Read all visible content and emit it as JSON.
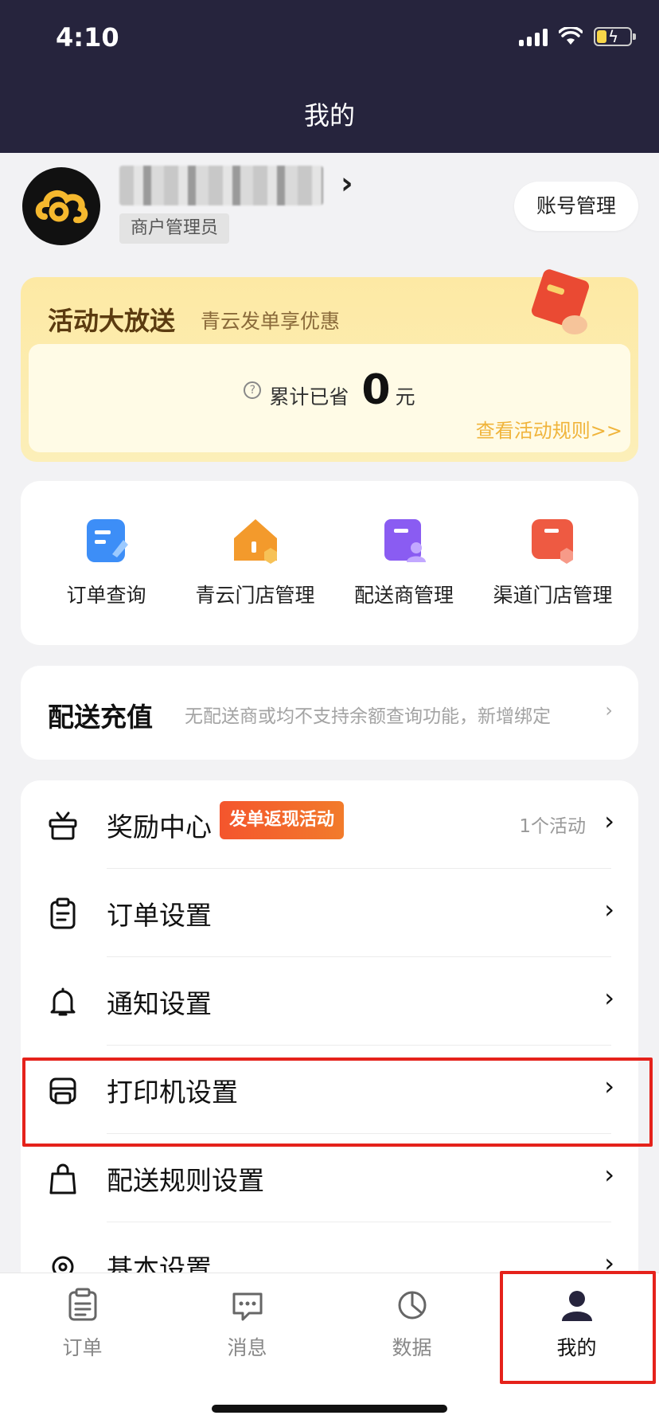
{
  "status_bar": {
    "time": "4:10"
  },
  "header": {
    "title": "我的"
  },
  "profile": {
    "name": "████████",
    "role": "商户管理员",
    "account_button": "账号管理"
  },
  "promo": {
    "title": "活动大放送",
    "subtitle": "青云发单享优惠",
    "saved_label": "累计已省",
    "saved_value": "0",
    "saved_unit": "元",
    "rules_link": "查看活动规则>>"
  },
  "shortcuts": [
    {
      "label": "订单查询",
      "icon": "order-search-icon",
      "color": "#3d8ef7"
    },
    {
      "label": "青云门店管理",
      "icon": "store-icon",
      "color": "#f39a2c"
    },
    {
      "label": "配送商管理",
      "icon": "courier-icon",
      "color": "#8a5cf2"
    },
    {
      "label": "渠道门店管理",
      "icon": "channel-store-icon",
      "color": "#ee5a42"
    }
  ],
  "recharge": {
    "title": "配送充值",
    "note": "无配送商或均不支持余额查询功能，新增绑定"
  },
  "settings": {
    "items": [
      {
        "label": "奖励中心",
        "icon": "gift-icon",
        "badge": "发单返现活动",
        "count": "1个活动"
      },
      {
        "label": "订单设置",
        "icon": "clipboard-icon"
      },
      {
        "label": "通知设置",
        "icon": "bell-icon"
      },
      {
        "label": "打印机设置",
        "icon": "printer-icon"
      },
      {
        "label": "配送规则设置",
        "icon": "bag-icon"
      },
      {
        "label": "基本设置",
        "icon": "settings-gear-icon"
      }
    ]
  },
  "tabbar": {
    "tabs": [
      {
        "label": "订单",
        "icon": "order-tab-icon"
      },
      {
        "label": "消息",
        "icon": "message-tab-icon"
      },
      {
        "label": "数据",
        "icon": "data-tab-icon"
      },
      {
        "label": "我的",
        "icon": "profile-tab-icon",
        "active": true
      }
    ]
  },
  "colors": {
    "header_bg": "#26243d",
    "accent_red": "#e5221b",
    "promo_link": "#f0b43b"
  }
}
